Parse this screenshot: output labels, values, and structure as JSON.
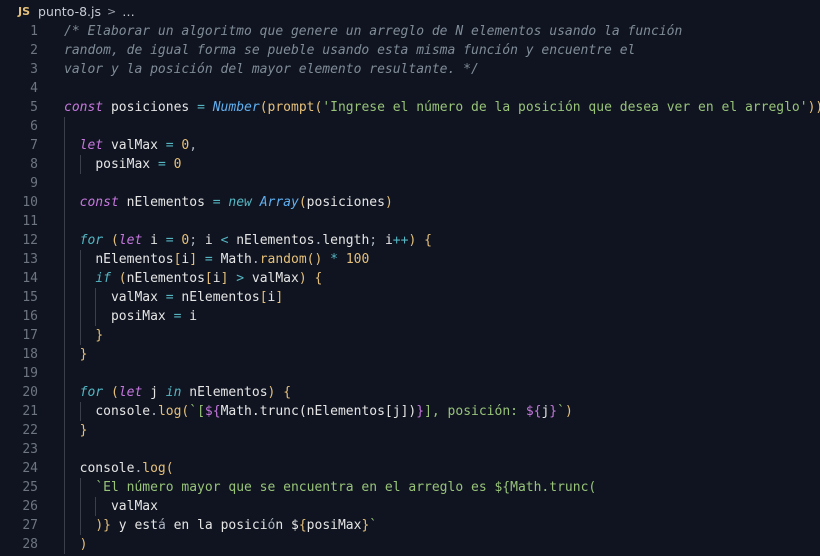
{
  "breadcrumb": {
    "file_badge": "JS",
    "file_name": "punto-8.js",
    "separator": ">",
    "more": "…"
  },
  "editor": {
    "line_numbers": [
      "1",
      "2",
      "3",
      "4",
      "5",
      "6",
      "7",
      "8",
      "9",
      "10",
      "11",
      "12",
      "13",
      "14",
      "15",
      "16",
      "17",
      "18",
      "19",
      "20",
      "21",
      "22",
      "23",
      "24",
      "25",
      "26",
      "27",
      "28"
    ],
    "lines": [
      "/* Elaborar un algoritmo que genere un arreglo de N elementos usando la función",
      "random, de igual forma se pueble usando esta misma función y encuentre el",
      "valor y la posición del mayor elemento resultante. */",
      "",
      "const posiciones = Number(prompt('Ingrese el número de la posición que desea ver en el arreglo'))",
      "",
      "  let valMax = 0,",
      "    posiMax = 0",
      "",
      "  const nElementos = new Array(posiciones)",
      "",
      "  for (let i = 0; i < nElementos.length; i++) {",
      "    nElementos[i] = Math.random() * 100",
      "    if (nElementos[i] > valMax) {",
      "      valMax = nElementos[i]",
      "      posiMax = i",
      "    }",
      "  }",
      "",
      "  for (let j in nElementos) {",
      "    console.log(`[${Math.trunc(nElementos[j])}], posición: ${j}`)",
      "  }",
      "",
      "  console.log(",
      "    `El número mayor que se encuentra en el arreglo es ${Math.trunc(",
      "      valMax",
      "    )} y está en la posición ${posiMax}`",
      "  )"
    ]
  }
}
